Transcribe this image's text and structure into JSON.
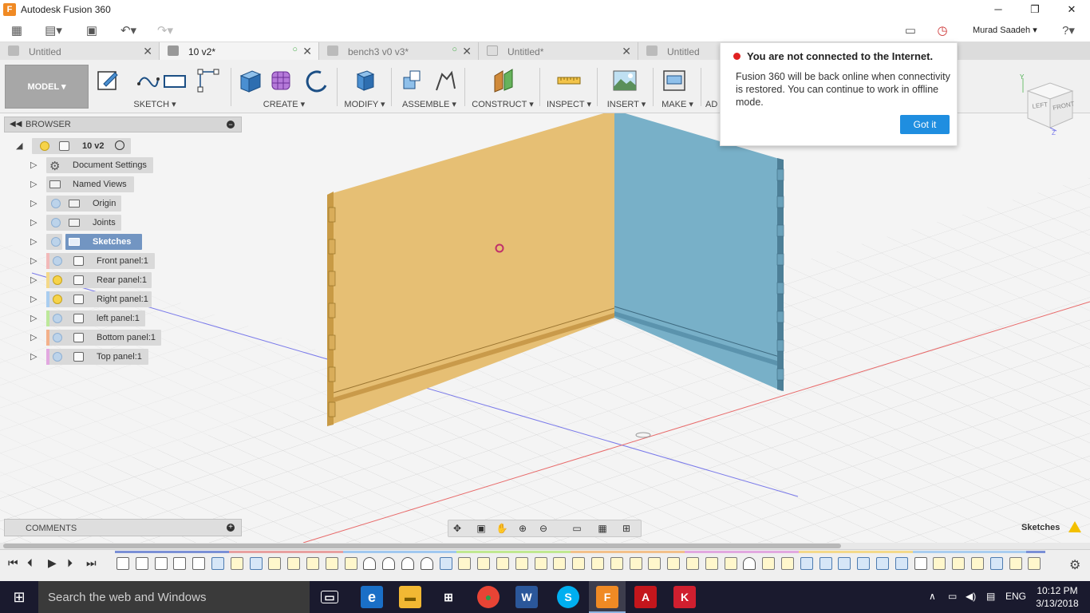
{
  "window": {
    "title": "Autodesk Fusion 360",
    "logo_letter": "F",
    "min_glyph": "─",
    "max_glyph": "❐",
    "close_glyph": "✕"
  },
  "qat": {
    "user_name": "Murad Saadeh ▾",
    "grid_glyph": "▦",
    "file_glyph": "▤▾",
    "save_glyph": "▣",
    "undo_glyph": "↶▾",
    "redo_glyph": "↷▾",
    "chat_glyph": "▭",
    "clock_glyph": "◷",
    "help_glyph": "?▾"
  },
  "tabs": [
    {
      "label": "Untitled",
      "active": false,
      "sync": ""
    },
    {
      "label": "10 v2*",
      "active": true,
      "sync": "○"
    },
    {
      "label": "bench3 v0 v3*",
      "active": false,
      "sync": "○"
    },
    {
      "label": "Untitled*",
      "active": false,
      "sync": ""
    },
    {
      "label": "Untitled",
      "active": false,
      "sync": ""
    }
  ],
  "toolbar": {
    "model_label": "MODEL ▾",
    "groups": {
      "sketch": "SKETCH ▾",
      "create": "CREATE ▾",
      "modify": "MODIFY ▾",
      "assemble": "ASSEMBLE ▾",
      "construct": "CONSTRUCT ▾",
      "inspect": "INSPECT ▾",
      "insert": "INSERT ▾",
      "make": "MAKE ▾",
      "addins": "AD"
    }
  },
  "browser": {
    "label": "BROWSER",
    "root_label": "10 v2",
    "items": [
      {
        "label": "Document Settings",
        "selected": false
      },
      {
        "label": "Named Views",
        "selected": false
      },
      {
        "label": "Origin",
        "selected": false
      },
      {
        "label": "Joints",
        "selected": false
      },
      {
        "label": "Sketches",
        "selected": true
      },
      {
        "label": "Front panel:1",
        "selected": false,
        "color": "#f2b9b9",
        "bulb": false
      },
      {
        "label": "Rear panel:1",
        "selected": false,
        "color": "#f4d98a",
        "bulb": true
      },
      {
        "label": "Right panel:1",
        "selected": false,
        "color": "#a9cdf0",
        "bulb": true
      },
      {
        "label": "left panel:1",
        "selected": false,
        "color": "#bde89a",
        "bulb": false
      },
      {
        "label": "Bottom panel:1",
        "selected": false,
        "color": "#f3b08a",
        "bulb": false
      },
      {
        "label": "Top panel:1",
        "selected": false,
        "color": "#e2a8e0",
        "bulb": false
      }
    ]
  },
  "comments": {
    "label": "COMMENTS"
  },
  "status": {
    "mode_label": "Sketches"
  },
  "toast": {
    "title": "You are not connected to the Internet.",
    "message": "Fusion 360 will be back online when connectivity is restored. You can continue to work in offline mode.",
    "button_label": "Got it"
  },
  "viewcube": {
    "left_label": "LEFT",
    "front_label": "FRONT",
    "z_label": "Z",
    "y_label": "Y"
  },
  "colors": {
    "panel_front": "#e6bf74",
    "panel_side": "#78b0c8",
    "accent_blue": "#1f8ee0",
    "error_red": "#e02020"
  },
  "timeline": {
    "first_glyph": "⏮",
    "prev_glyph": "⏴",
    "play_glyph": "▶",
    "next_glyph": "⏵",
    "last_glyph": "⏭",
    "gear_glyph": "⚙"
  },
  "taskbar": {
    "search_placeholder": "Search the web and Windows",
    "language": "ENG",
    "time": "10:12 PM",
    "date": "3/13/2018",
    "start_glyph": "⊞",
    "chevron_glyph": "∧",
    "battery_glyph": "▭",
    "volume_glyph": "◀)",
    "notif_glyph": "▤",
    "apps": {
      "taskview_glyph": "▭",
      "edge_glyph": "e",
      "explorer_glyph": "▬",
      "store_glyph": "⊞",
      "chrome_glyph": "●",
      "word_glyph": "W",
      "skype_glyph": "S",
      "fusion_glyph": "F",
      "acrobat_glyph": "A",
      "kaspersky_glyph": "K"
    }
  }
}
